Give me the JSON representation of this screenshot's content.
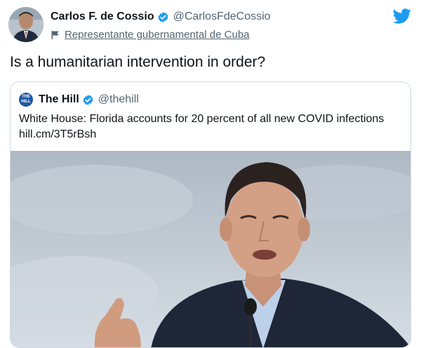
{
  "tweet": {
    "author": {
      "display_name": "Carlos F. de Cossio",
      "handle": "@CarlosFdeCossio",
      "label": "Representante gubernamental de Cuba"
    },
    "text": "Is a humanitarian intervention in order?",
    "icons": [
      "twitter-bird-icon",
      "verified-badge-icon",
      "flag-icon"
    ],
    "colors": {
      "brand_blue": "#1d9bf0",
      "secondary_text": "#536471",
      "border": "#cfd9de"
    }
  },
  "quoted_tweet": {
    "author": {
      "display_name": "The Hill",
      "handle": "@thehill",
      "avatar_text": "THE HILL"
    },
    "text": "White House: Florida accounts for 20 percent of all new COVID infections",
    "link": "hill.cm/3T5rBsh"
  }
}
